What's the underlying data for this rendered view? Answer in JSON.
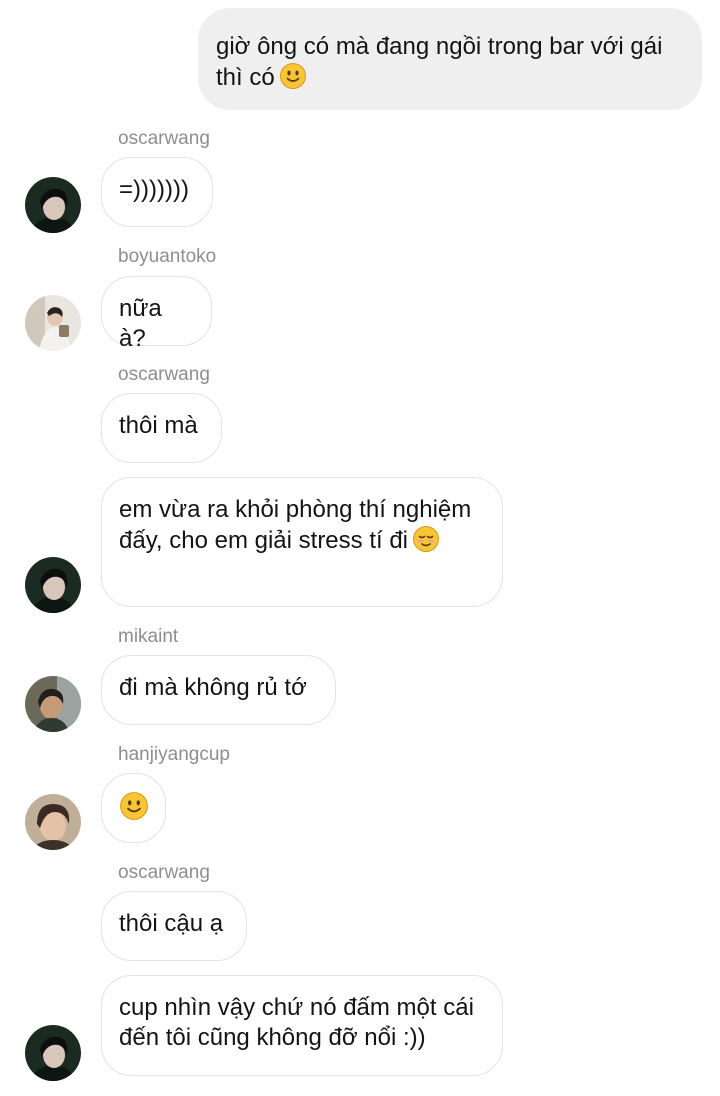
{
  "conversation": {
    "outgoing": {
      "text": "giờ ông có mà đang ngồi trong bar với gái thì có",
      "emoji": "slightly-smiling-face"
    },
    "messages": [
      {
        "username": "oscarwang",
        "text": "=)))))))"
      },
      {
        "username": "boyuantoko",
        "text": "nữa à?"
      },
      {
        "username": "oscarwang",
        "text": "thôi mà"
      },
      {
        "text": "em vừa ra khỏi phòng thí nghiệm đấy, cho em giải stress tí đi",
        "emoji": "relieved-face"
      },
      {
        "username": "mikaint",
        "text": "đi mà không rủ tớ"
      },
      {
        "username": "hanjiyangcup",
        "emoji": "slightly-smiling-face"
      },
      {
        "username": "oscarwang",
        "text": "thôi cậu ạ"
      },
      {
        "text": "cup nhìn vậy chứ nó đấm một cái đến tôi cũng không đỡ nổi :))"
      }
    ]
  },
  "colors": {
    "outgoing_bubble": "#efefef",
    "incoming_border": "#e3e3e3",
    "username": "#8e8e8e",
    "emoji_face": "#f8c537"
  }
}
